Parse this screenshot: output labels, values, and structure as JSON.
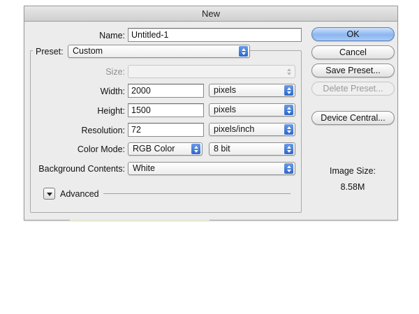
{
  "dialog": {
    "title": "New",
    "name_label": "Name:",
    "name_value": "Untitled-1",
    "preset_label": "Preset:",
    "preset_value": "Custom",
    "size_label": "Size:",
    "size_value": "",
    "width_label": "Width:",
    "width_value": "2000",
    "width_unit": "pixels",
    "height_label": "Height:",
    "height_value": "1500",
    "height_unit": "pixels",
    "resolution_label": "Resolution:",
    "resolution_value": "72",
    "resolution_unit": "pixels/inch",
    "color_mode_label": "Color Mode:",
    "color_mode_value": "RGB Color",
    "bit_depth_value": "8 bit",
    "background_label": "Background Contents:",
    "background_value": "White",
    "advanced_label": "Advanced"
  },
  "buttons": {
    "ok": "OK",
    "cancel": "Cancel",
    "save_preset": "Save Preset...",
    "delete_preset": "Delete Preset...",
    "device_central": "Device Central..."
  },
  "image_size": {
    "label": "Image Size:",
    "value": "8.58M"
  },
  "colors": {
    "accent": "#2a67cf",
    "default_button": "#8ab6ef"
  }
}
